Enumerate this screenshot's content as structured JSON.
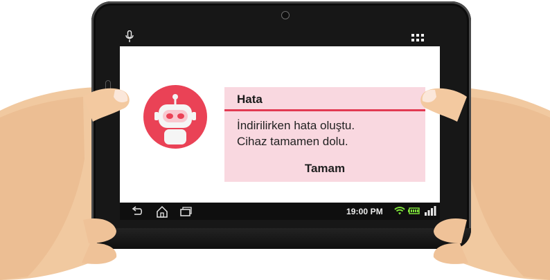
{
  "dialog": {
    "title": "Hata",
    "message_lines": [
      "İndirilirken hata oluştu.",
      "Cihaz tamamen dolu."
    ],
    "ok_label": "Tamam"
  },
  "status_bar": {
    "time": "19:00 PM"
  },
  "icons": {
    "microphone": "microphone-icon",
    "apps": "apps-grid-icon",
    "back": "back-icon",
    "home": "home-icon",
    "recent": "recent-apps-icon",
    "wifi": "wifi-icon",
    "battery": "battery-icon",
    "signal": "signal-icon",
    "avatar": "robot-icon"
  },
  "colors": {
    "accent": "#e23a52",
    "avatar_bg": "#ea4256",
    "dialog_bg": "#f9d8e0",
    "wifi": "#7ee23a",
    "battery": "#7ee23a",
    "signal": "#7ee23a"
  }
}
